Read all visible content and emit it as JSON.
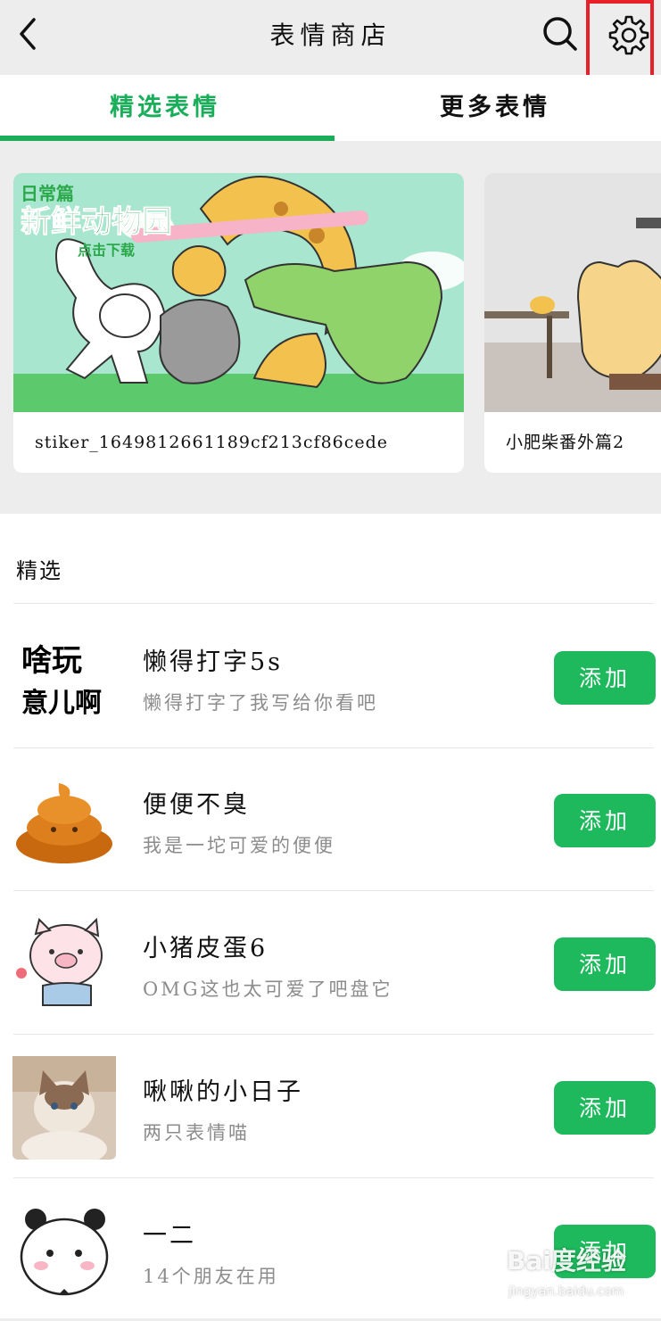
{
  "header": {
    "title": "表情商店",
    "back_icon": "chevron-left-icon",
    "search_icon": "search-icon",
    "settings_icon": "gear-icon"
  },
  "tabs": [
    {
      "label": "精选表情",
      "active": true
    },
    {
      "label": "更多表情",
      "active": false
    }
  ],
  "banners": [
    {
      "caption": "stiker_1649812661189cf213cf86cede",
      "art_text_1": "日常篇",
      "art_text_2": "新鲜动物园",
      "art_text_3": "点击下载"
    },
    {
      "caption": "小肥柴番外篇2"
    }
  ],
  "section": {
    "label": "精选"
  },
  "items": [
    {
      "title": "懒得打字5s",
      "subtitle": "懒得打字了我写给你看吧",
      "button": "添加",
      "thumb_text_1": "啥玩",
      "thumb_text_2": "意儿啊"
    },
    {
      "title": "便便不臭",
      "subtitle": "我是一坨可爱的便便",
      "button": "添加"
    },
    {
      "title": "小猪皮蛋6",
      "subtitle": "OMG这也太可爱了吧盘它",
      "button": "添加"
    },
    {
      "title": "啾啾的小日子",
      "subtitle": "两只表情喵",
      "button": "添加"
    },
    {
      "title": "一二",
      "subtitle": "14个朋友在用",
      "button": "添加"
    }
  ],
  "watermark": {
    "main": "Bai度经验",
    "sub": "jingyan.baidu.com"
  },
  "colors": {
    "accent": "#1aad5a",
    "button": "#1db95c",
    "highlight": "#e8202a",
    "background": "#ededed"
  }
}
